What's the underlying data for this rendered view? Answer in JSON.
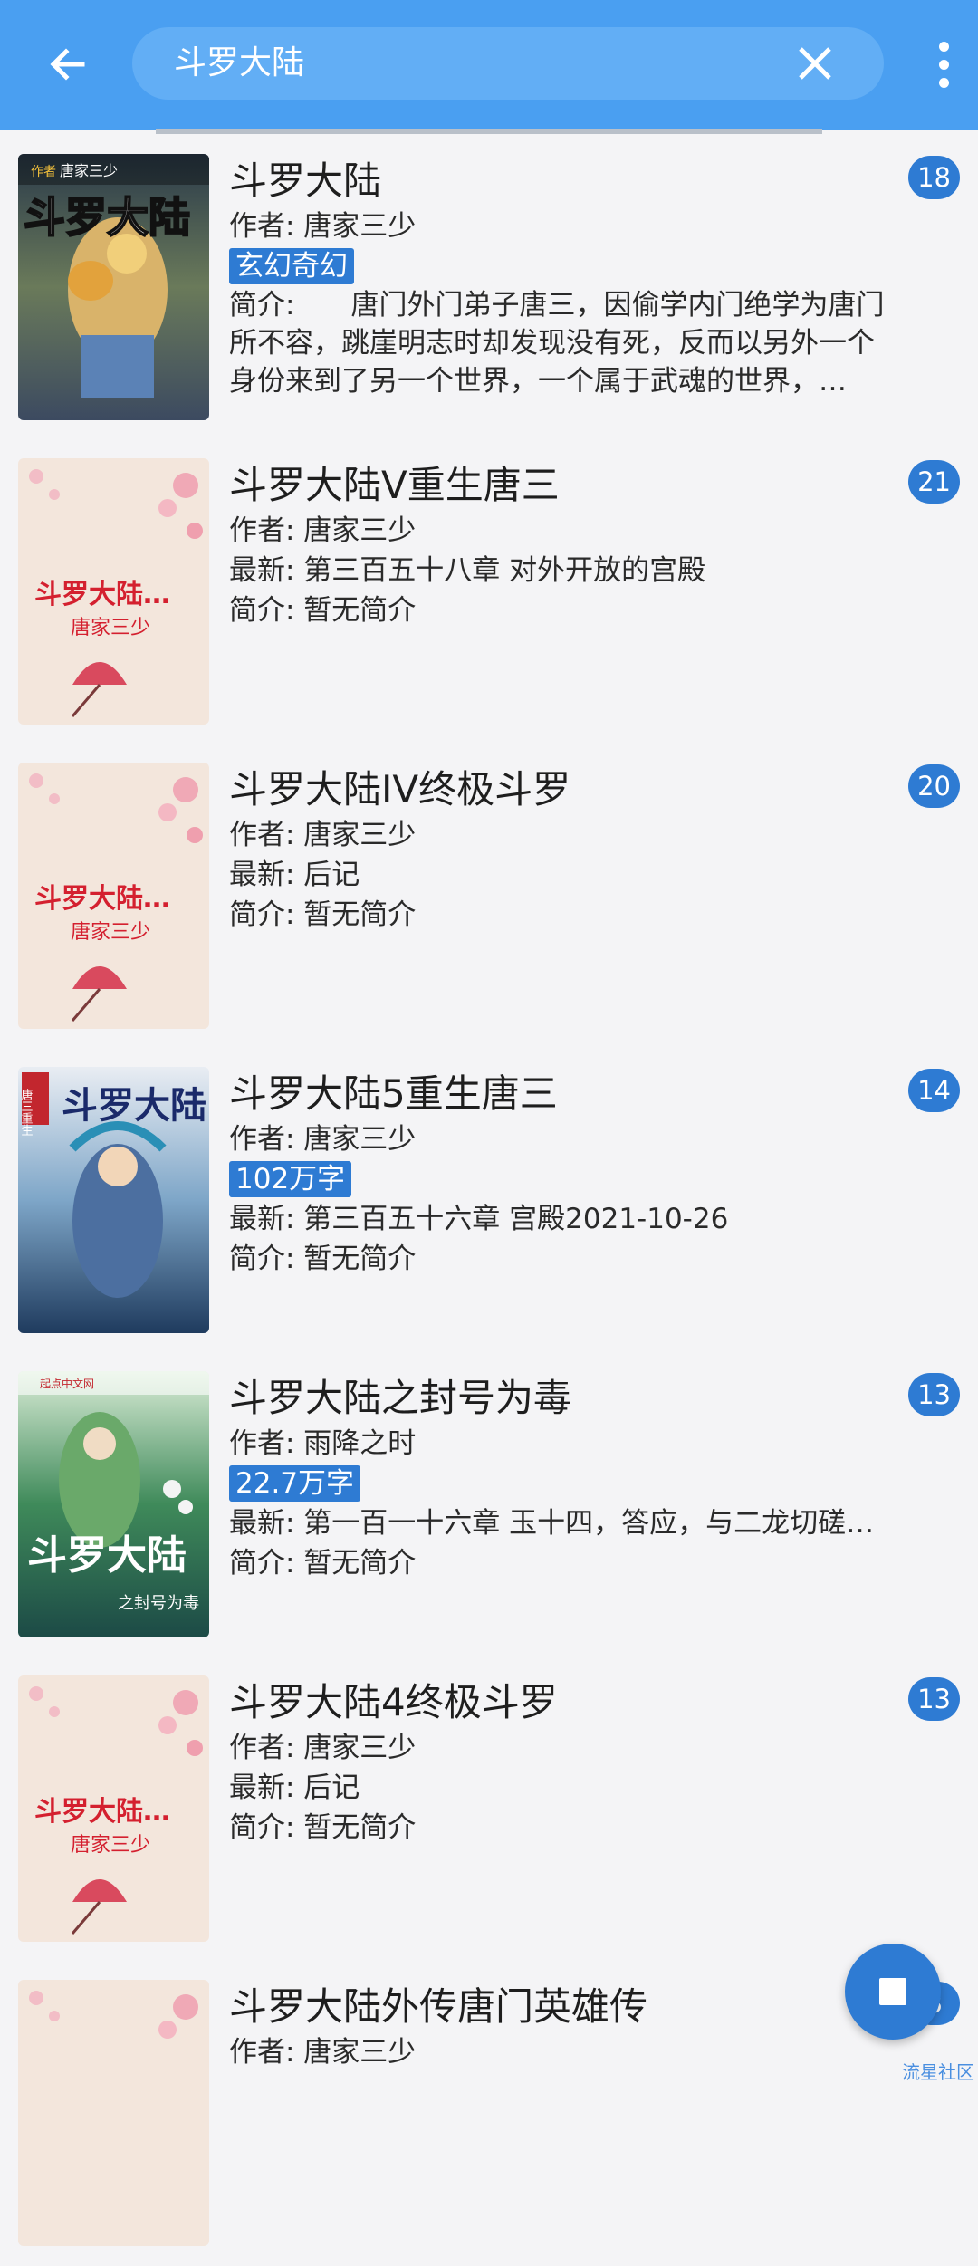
{
  "search": {
    "query": "斗罗大陆"
  },
  "books": [
    {
      "title": "斗罗大陆",
      "author_line": "作者: 唐家三少",
      "tag": "玄幻奇幻",
      "latest_line": "",
      "intro_line": "简介:　　唐门外门弟子唐三，因偷学内门绝学为唐门所不容，跳崖明志时却发现没有死，反而以另外一个身份来到了另一个世界，一个属于武魂的世界，…",
      "count": "18",
      "cover": "art-1"
    },
    {
      "title": "斗罗大陆V重生唐三",
      "author_line": "作者: 唐家三少",
      "tag": "",
      "latest_line": "最新: 第三百五十八章 对外开放的宫殿",
      "intro_line": "简介: 暂无简介",
      "count": "21",
      "cover": "default"
    },
    {
      "title": "斗罗大陆IV终极斗罗",
      "author_line": "作者: 唐家三少",
      "tag": "",
      "latest_line": "最新: 后记",
      "intro_line": "简介: 暂无简介",
      "count": "20",
      "cover": "default"
    },
    {
      "title": "斗罗大陆5重生唐三",
      "author_line": "作者: 唐家三少",
      "tag": "102万字",
      "latest_line": "最新: 第三百五十六章 宫殿2021-10-26",
      "intro_line": "简介: 暂无简介",
      "count": "14",
      "cover": "art-4"
    },
    {
      "title": "斗罗大陆之封号为毒",
      "author_line": "作者: 雨降之时",
      "tag": "22.7万字",
      "latest_line": "最新: 第一百一十六章 玉十四，答应，与二龙切磋…",
      "intro_line": "简介: 暂无简介",
      "count": "13",
      "cover": "art-5"
    },
    {
      "title": "斗罗大陆4终极斗罗",
      "author_line": "作者: 唐家三少",
      "tag": "",
      "latest_line": "最新: 后记",
      "intro_line": "简介: 暂无简介",
      "count": "13",
      "cover": "default"
    },
    {
      "title": "斗罗大陆外传唐门英雄传",
      "author_line": "作者: 唐家三少",
      "tag": "",
      "latest_line": "",
      "intro_line": "",
      "count": "3",
      "cover": "default"
    }
  ],
  "covers": {
    "art_1_title": "斗罗大陆",
    "art_1_author": "唐家三少",
    "art_1_author_prefix": "作者",
    "default_title": "斗罗大陆…",
    "default_author": "唐家三少",
    "art_4_title": "斗罗大陆",
    "art_4_badge": "唐三重生",
    "art_5_title": "斗罗大陆",
    "art_5_subtitle": "之封号为毒",
    "art_5_publisher": "起点中文网"
  },
  "watermark": "流星社区",
  "colors": {
    "appbar": "#4a9ff1",
    "accent": "#2e7bd3",
    "background": "#f4f4f6"
  },
  "icons": {
    "back": "arrow-left-icon",
    "clear": "close-icon",
    "more": "more-vertical-icon",
    "fab": "stop-icon"
  }
}
